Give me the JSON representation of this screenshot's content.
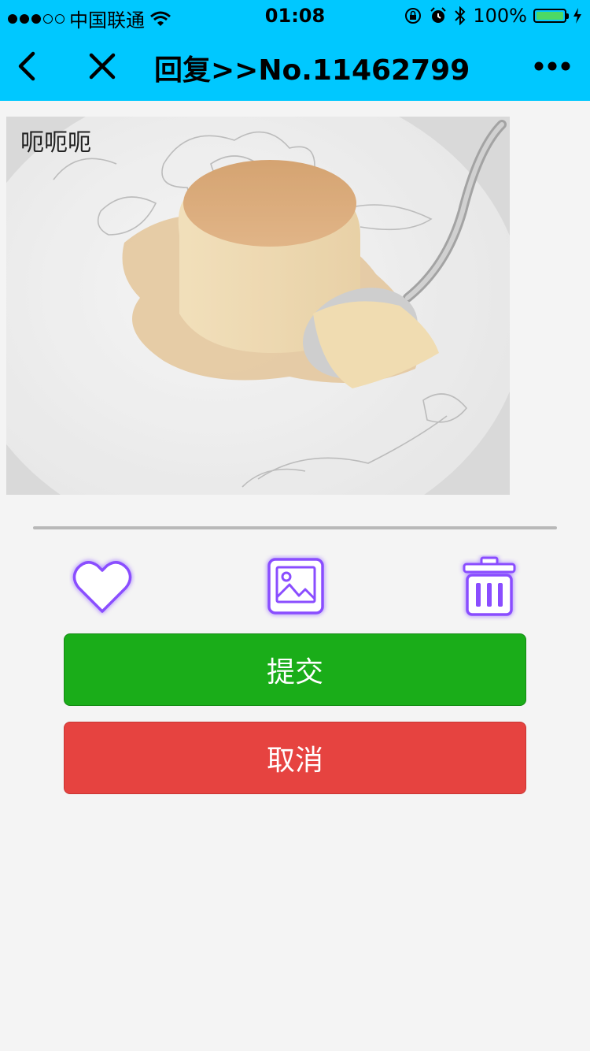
{
  "status_bar": {
    "carrier": "中国联通",
    "time": "01:08",
    "battery": "100%",
    "signal_full_dots": 3,
    "signal_empty_dots": 2
  },
  "nav": {
    "title": "回复>>No.11462799",
    "back_icon": "chevron-left-icon",
    "close_icon": "close-icon",
    "more_icon": "more-dots-icon"
  },
  "photo": {
    "caption": "呃呃呃",
    "subject": "custard pudding on plate with spoon"
  },
  "actions": {
    "like_icon": "heart-icon",
    "image_icon": "image-icon",
    "delete_icon": "trash-icon",
    "glow_color": "#8a4dff"
  },
  "buttons": {
    "submit_label": "提交",
    "cancel_label": "取消",
    "submit_color": "#1aad19",
    "cancel_color": "#e64340"
  },
  "theme": {
    "header_color": "#00c8ff"
  }
}
